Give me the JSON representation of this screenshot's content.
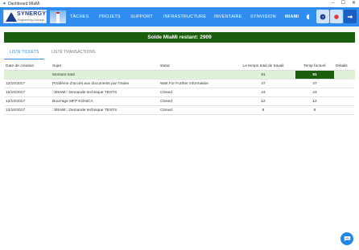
{
  "window": {
    "title": "Dashboard MIaMi",
    "minimize": "–",
    "maximize": "☐",
    "close": "✕"
  },
  "logo": {
    "brand": "SYNERGY",
    "tagline": "Engineering Concept"
  },
  "nav": {
    "items": [
      "TÂCHES",
      "PROJETS",
      "SUPPORT",
      "INFRASTRUCTURE",
      "INVENTAIRE",
      "SYNVISION",
      "MIAMI"
    ],
    "active": "MIAMI"
  },
  "banner": {
    "text": "Solde MIaMi restant: 2909"
  },
  "tabs": [
    {
      "label": "LISTE TICKETS",
      "active": true
    },
    {
      "label": "LISTE TRANSACTIONS",
      "active": false
    }
  ],
  "table": {
    "headers": [
      "Date de création",
      "Sujet",
      "statut",
      "Le temps total de travail",
      "Temp facturé",
      "Détails"
    ],
    "total": {
      "label": "Montant total",
      "worked": "91",
      "billed": "91"
    },
    "rows": [
      {
        "date": "12/10/2017",
        "subject": "Problème d'accès aux documents par l'Index",
        "status": "Wait For Further Information",
        "worked": "47",
        "billed": "47"
      },
      {
        "date": "12/10/2017",
        "subject": "::MIAMI:: Demande technique TESTS",
        "status": "Closed",
        "worked": "24",
        "billed": "24"
      },
      {
        "date": "12/10/2017",
        "subject": "Bourrage MFP KONICA",
        "status": "Closed",
        "worked": "12",
        "billed": "12"
      },
      {
        "date": "12/10/2017",
        "subject": "::MIAMI:: Demande technique TESTS",
        "status": "Closed",
        "worked": "8",
        "billed": "8"
      }
    ]
  },
  "colors": {
    "nav": "#2f8df0",
    "banner": "#1b5e0c",
    "total_row": "#dff1d7",
    "chat": "#1e88e5"
  },
  "icons": [
    "theme-icon",
    "help-icon",
    "record-icon",
    "logout-icon",
    "chat-icon"
  ]
}
